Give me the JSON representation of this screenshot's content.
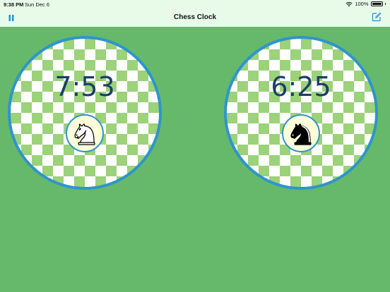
{
  "status_bar": {
    "time": "9:38 PM",
    "date": "Sun Dec 6",
    "battery_percent": "100%",
    "battery_level": 1.0
  },
  "nav": {
    "title": "Chess Clock",
    "left_icon": "pause-icon",
    "right_icon": "edit-icon"
  },
  "clocks": [
    {
      "player": "white",
      "time": "7:53",
      "piece_icon": "white-knight-icon"
    },
    {
      "player": "black",
      "time": "6:25",
      "piece_icon": "black-knight-icon"
    }
  ],
  "colors": {
    "background": "#66b96a",
    "header": "#e8fbe9",
    "board_light": "#ffffff",
    "board_dark": "#9bd27a",
    "ring": "#2e95cb",
    "time_text": "#1b3f66",
    "badge": "#ffffd9",
    "accent": "#1a8ed8"
  }
}
